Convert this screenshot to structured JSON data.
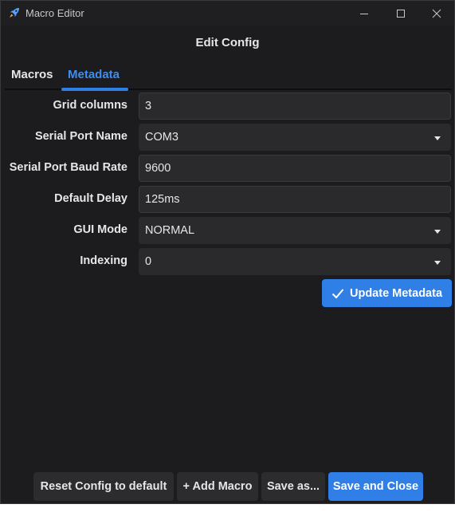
{
  "window": {
    "title": "Macro Editor"
  },
  "dialog": {
    "title": "Edit Config"
  },
  "tabs": [
    {
      "label": "Macros",
      "active": false
    },
    {
      "label": "Metadata",
      "active": true
    }
  ],
  "form": {
    "grid_columns": {
      "label": "Grid columns",
      "value": "3"
    },
    "serial_port_name": {
      "label": "Serial Port Name",
      "value": "COM3"
    },
    "serial_port_baud_rate": {
      "label": "Serial Port Baud Rate",
      "value": "9600"
    },
    "default_delay": {
      "label": "Default Delay",
      "value": "125ms"
    },
    "gui_mode": {
      "label": "GUI Mode",
      "value": "NORMAL"
    },
    "indexing": {
      "label": "Indexing",
      "value": "0"
    }
  },
  "buttons": {
    "update_metadata": "Update Metadata",
    "reset_config": "Reset Config to default",
    "add_macro": "+ Add Macro",
    "save_as": "Save as...",
    "save_and_close": "Save and Close"
  },
  "colors": {
    "accent": "#2f7fe6",
    "background": "#1c1c1e",
    "field": "#2a2a2d",
    "text": "#e6e6e6"
  }
}
